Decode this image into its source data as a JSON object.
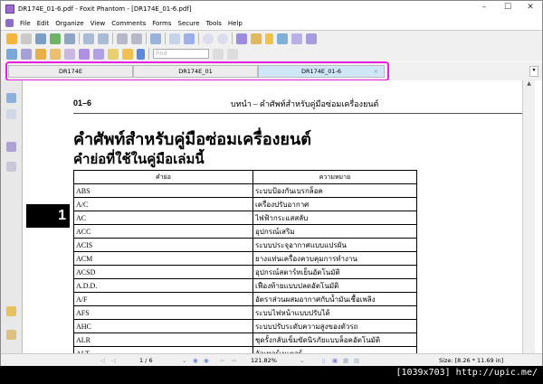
{
  "window": {
    "title": "DR174E_01-6.pdf - Foxit Phantom - [DR174E_01-6.pdf]",
    "minimize": "–",
    "maximize": "☐",
    "close": "✕"
  },
  "menu": [
    "File",
    "Edit",
    "Organize",
    "View",
    "Comments",
    "Forms",
    "Secure",
    "Tools",
    "Help"
  ],
  "toolbar": {
    "find_placeholder": "Find"
  },
  "tabs": [
    {
      "label": "DR174E"
    },
    {
      "label": "DR174E_01"
    },
    {
      "label": "DR174E_01-6",
      "close": "×"
    }
  ],
  "page": {
    "chapter_tab": "1",
    "header_num": "01–6",
    "header_title": "บทนำ – คำศัพท์สำหรับคู่มือซ่อมเครื่องยนต์",
    "title": "คำศัพท์สำหรับคู่มือซ่อมเครื่องยนต์",
    "subtitle": "คำย่อที่ใช้ในคู่มือเล่มนี้",
    "table": {
      "headers": [
        "คำย่อ",
        "ความหมาย"
      ],
      "rows": [
        [
          "ABS",
          "ระบบป้องกันเบรกล็อค"
        ],
        [
          "A/C",
          "เครื่องปรับอากาศ"
        ],
        [
          "AC",
          "ไฟฟ้ากระแสสลับ"
        ],
        [
          "ACC",
          "อุปกรณ์เสริม"
        ],
        [
          "ACIS",
          "ระบบประจุอากาศแบบแปรผัน"
        ],
        [
          "ACM",
          "ยางแท่นเครื่องควบคุมการทำงาน"
        ],
        [
          "ACSD",
          "อุปกรณ์สตาร์ทเย็นอัตโนมัติ"
        ],
        [
          "A.D.D.",
          "เฟืองท้ายแบบปลดอัตโนมัติ"
        ],
        [
          "A/F",
          "อัตราส่วนผสมอากาศกับน้ำมันเชื้อเพลิง"
        ],
        [
          "AFS",
          "ระบบไฟหน้าแบบปรับได้"
        ],
        [
          "AHC",
          "ระบบปรับระดับความสูงของตัวรถ"
        ],
        [
          "ALR",
          "ชุดรั้งกลับเข็มขัดนิรภัยแบบล็อคอัตโนมัติ"
        ],
        [
          "ALT",
          "อัลเทอร์เนเตอร์"
        ]
      ]
    }
  },
  "status": {
    "page": "1 / 6",
    "zoom": "121.82%",
    "size": "Size: [8.26 * 11.69 in]"
  },
  "watermark": "[1039x703] http://upic.me/"
}
